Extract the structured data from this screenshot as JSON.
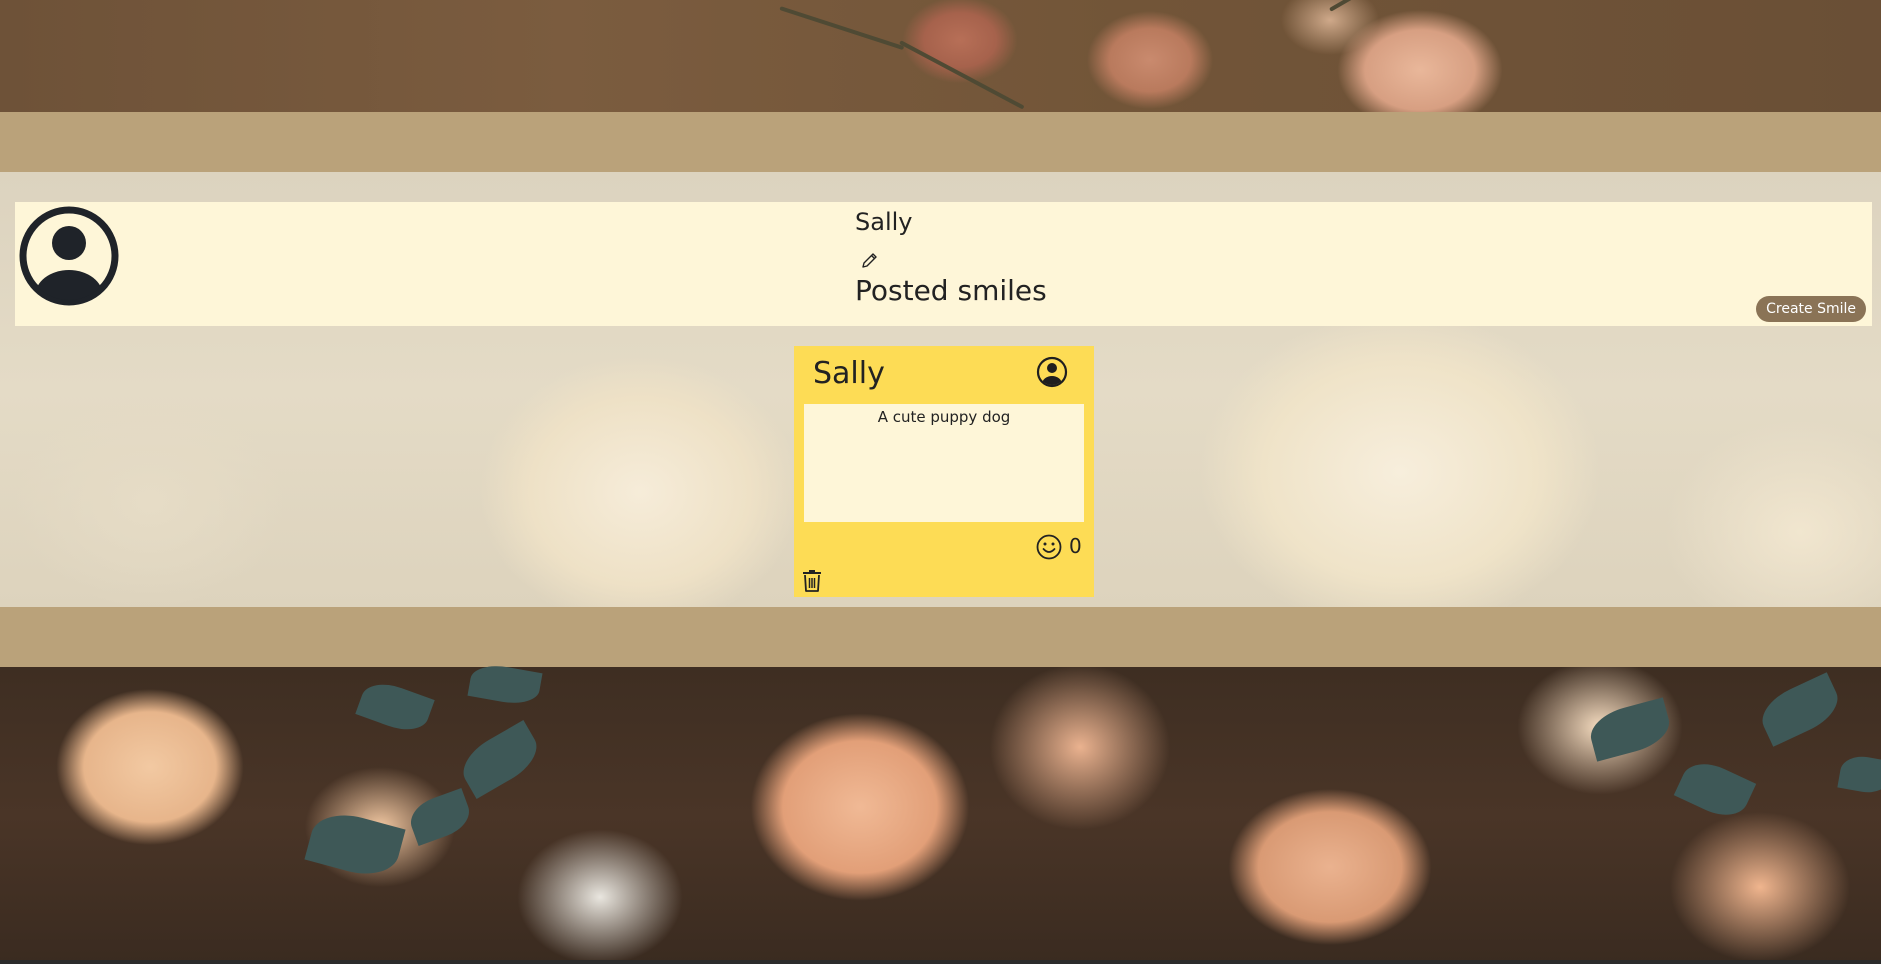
{
  "profile": {
    "username": "Sally",
    "section_title": "Posted smiles",
    "create_button_label": "Create Smile"
  },
  "icons": {
    "avatar": "user-circle-icon",
    "edit": "pencil-icon",
    "smile": "smiley-face-icon",
    "delete": "trash-icon"
  },
  "smiles": [
    {
      "author": "Sally",
      "message": "A cute puppy dog",
      "smile_count": "0"
    }
  ],
  "colors": {
    "card": "#fddc55",
    "panel": "#fef6d8",
    "band": "#baa27a",
    "button": "#8a7356"
  }
}
